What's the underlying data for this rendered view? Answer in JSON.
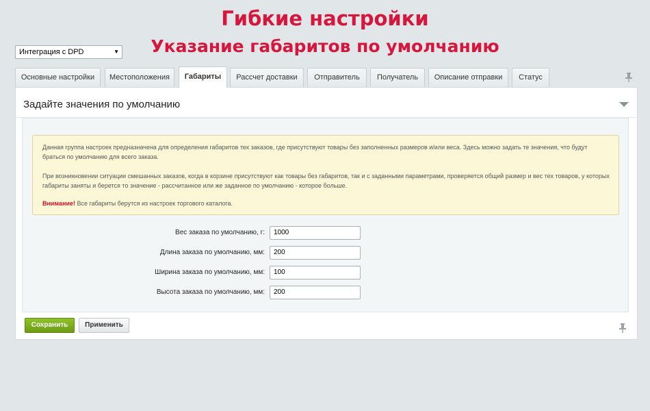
{
  "banner": {
    "line1": "Гибкие настройки",
    "line2": "Указание габаритов по умолчанию"
  },
  "site_select": {
    "value": "Интеграция с DPD"
  },
  "tabs": [
    {
      "label": "Основные настройки",
      "active": false
    },
    {
      "label": "Местоположения",
      "active": false
    },
    {
      "label": "Габариты",
      "active": true
    },
    {
      "label": "Рассчет доставки",
      "active": false
    },
    {
      "label": "Отправитель",
      "active": false
    },
    {
      "label": "Получатель",
      "active": false
    },
    {
      "label": "Описание отправки",
      "active": false
    },
    {
      "label": "Статус",
      "active": false
    }
  ],
  "panel": {
    "title": "Задайте значения по умолчанию",
    "note": {
      "p1": "Данная группа настроек предназначена для определения габаритов тех заказов, где присутствуют товары без заполненных размеров и/или веса. Здесь можно задать те значения, что будут браться по умолчанию для всего заказа.",
      "p2": "При возникновении ситуации смешанных заказов, когда в корзине присутствуют как товары без габаритов, так и с заданными параметрами, проверяется общий размер и вес тех товаров, у которых габариты заняты и берется то значение - рассчитанное или же заданное по умолчанию - которое больше.",
      "warning_label": "Внимание!",
      "warning_text": " Все габариты берутся из настроек торгового каталога."
    },
    "fields": {
      "weight": {
        "label": "Вес заказа по умолчанию, г:",
        "value": "1000"
      },
      "length": {
        "label": "Длина заказа по умолчанию, мм:",
        "value": "200"
      },
      "width": {
        "label": "Ширина заказа по умолчанию, мм:",
        "value": "100"
      },
      "height": {
        "label": "Высота заказа по умолчанию, мм:",
        "value": "200"
      }
    }
  },
  "buttons": {
    "save": "Сохранить",
    "apply": "Применить"
  },
  "colors": {
    "banner_text": "#d6163d",
    "save_button": "#7aae1b",
    "warning": "#d60f24",
    "note_background": "#fbf7d7",
    "page_background": "#e1e6e8"
  }
}
